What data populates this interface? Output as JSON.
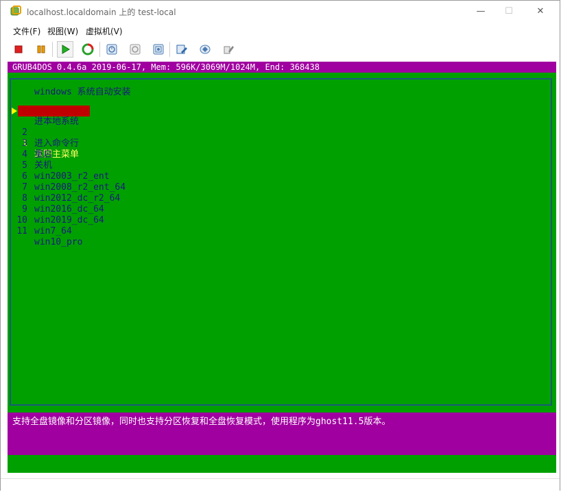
{
  "background_app": {
    "fragments": [
      "cu",
      "p",
      "单",
      "水"
    ]
  },
  "window": {
    "title": "localhost.localdomain 上的 test-local",
    "controls": {
      "minimize": "—",
      "maximize": "☐",
      "close": "✕"
    }
  },
  "menubar": {
    "items": [
      {
        "label": "文件(F)"
      },
      {
        "label": "视图(W)"
      },
      {
        "label": "虚拟机(V)"
      }
    ]
  },
  "toolbar": {
    "buttons": [
      {
        "icon": "stop-icon"
      },
      {
        "icon": "pause-icon"
      },
      {
        "icon": "play-icon"
      },
      {
        "icon": "reset-icon"
      },
      {
        "icon": "snapshot-take-icon"
      },
      {
        "icon": "snapshot-revert-icon"
      },
      {
        "icon": "snapshot-manager-icon"
      },
      {
        "icon": "vm-settings-icon"
      },
      {
        "icon": "install-tools-icon"
      },
      {
        "icon": "preferences-icon"
      }
    ]
  },
  "console": {
    "header": "GRUB4DOS 0.4.6a 2019-06-17, Mem: 596K/3069M/1024M, End: 368438",
    "menu_title": "windows 系统自动安装",
    "entries": [
      {
        "num": "0",
        "label": "进本地系统"
      },
      {
        "num": "1",
        "label": "返回主菜单",
        "selected": true
      },
      {
        "num": "2",
        "label": "进入命令行"
      },
      {
        "num": "3",
        "label": "重启"
      },
      {
        "num": "4",
        "label": "关机"
      },
      {
        "num": "5",
        "label": "win2003_r2_ent"
      },
      {
        "num": "6",
        "label": "win2008_r2_ent_64"
      },
      {
        "num": "7",
        "label": "win2012_dc_r2_64"
      },
      {
        "num": "8",
        "label": "win2016_dc_64"
      },
      {
        "num": "9",
        "label": "win2019_dc_64"
      },
      {
        "num": "10",
        "label": "win7_64"
      },
      {
        "num": "11",
        "label": "win10_pro"
      }
    ],
    "description": "支持全盘镜像和分区镜像，同时也支持分区恢复和全盘恢复模式，使用程序为ghost11.5版本。",
    "colors": {
      "background": "#00a000",
      "bars": "#a000a0",
      "text": "#1a1a80",
      "selected_bg": "#c00000",
      "selected_fg": "#ffff66"
    }
  }
}
